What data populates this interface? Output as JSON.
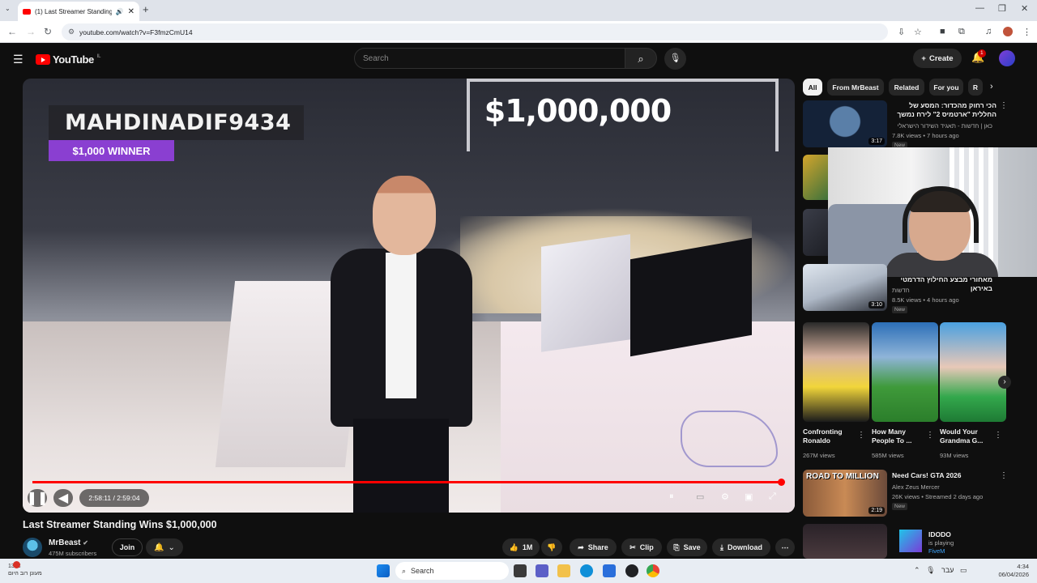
{
  "browser": {
    "tab_title": "(1) Last Streamer Standing",
    "tab_close": "✕",
    "new_tab": "+",
    "url": "youtube.com/watch?v=F3fmzCmU14"
  },
  "header": {
    "logo_text": "YouTube",
    "logo_region": "IL",
    "search_placeholder": "Search",
    "create_label": "Create",
    "notification_count": "1"
  },
  "video": {
    "overlay_name": "MAHDINADIF9434",
    "overlay_winner": "$1,000 WINNER",
    "overlay_prize": "$1,000,000",
    "time": "2:58:11 / 2:59:04",
    "progress": 0.995,
    "title": "Last Streamer Standing Wins $1,000,000"
  },
  "channel": {
    "name": "MrBeast",
    "subscribers": "475M subscribers",
    "join_label": "Join"
  },
  "actions": {
    "likes": "1M",
    "share": "Share",
    "clip": "Clip",
    "save": "Save",
    "download": "Download"
  },
  "chips": [
    "All",
    "From MrBeast",
    "Related",
    "For you",
    "R"
  ],
  "recommendations": [
    {
      "title": "הכי רחוק מהכדור: המסע של החללית \"ארטמיס 2\" לירח נמשך",
      "channel": "כאן | חדשות - תאגיד השידור הישראלי",
      "views": "7.8K views • 7 hours ago",
      "duration": "3:17",
      "badge": "New"
    },
    {
      "title": "מאחורי מבצע החילוץ הדרמטי באיראן",
      "channel": "חדשות",
      "views": "8.5K views • 4 hours ago",
      "duration": "3:10",
      "badge": "New"
    },
    {
      "title": "Need Cars! GTA 2026",
      "channel": "Alex Zeus Mercer",
      "views": "26K views • Streamed 2 days ago",
      "duration": "2:19",
      "badge": "New",
      "thumb_text": "ROAD TO MILLION"
    }
  ],
  "shorts": [
    {
      "title": "Confronting Ronaldo",
      "views": "267M views"
    },
    {
      "title": "How Many People To ...",
      "views": "585M views"
    },
    {
      "title": "Would Your Grandma G...",
      "views": "93M views"
    }
  ],
  "live_strip": {
    "name": "IDODO",
    "status": "is playing",
    "game": "FiveM"
  },
  "taskbar": {
    "weather_temp": "13°C",
    "weather_desc": "מעונן רוב היום",
    "search": "Search",
    "time": "4:34",
    "date": "06/04/2026",
    "lang": "עבר"
  }
}
